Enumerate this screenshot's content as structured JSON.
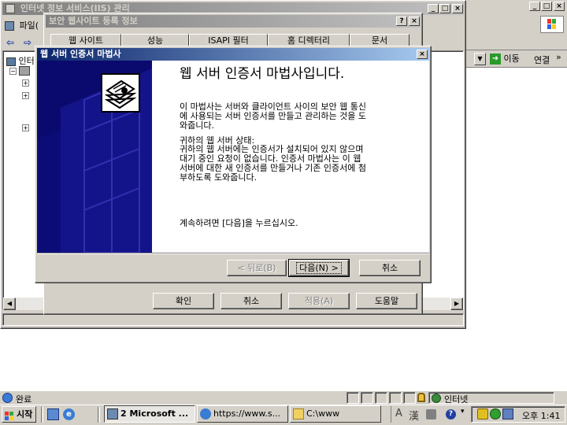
{
  "iis_window": {
    "title": "인터넷 정보 서비스(IIS) 관리",
    "menu_file": "파일(",
    "tree_root": "인터"
  },
  "props_dialog": {
    "title": "보안 웹사이트 등록 정보",
    "tabs": [
      "웹 사이트",
      "성능",
      "ISAPI 필터",
      "홈 디렉터리",
      "문서"
    ],
    "buttons": {
      "ok": "확인",
      "cancel": "취소",
      "apply": "적용(A)",
      "help": "도움말"
    }
  },
  "browser": {
    "go_label": "이동",
    "links_label": "연결",
    "status_text": "완료",
    "zone_text": "인터넷"
  },
  "wizard": {
    "title": "웹 서버 인증서 마법사",
    "heading": "웹 서버 인증서 마법사입니다.",
    "intro_line1": "이 마법사는 서버와 클라이언트 사이의 보안 웹 통신",
    "intro_line2": "에 사용되는 서버 인증서를 만들고 관리하는 것을 도",
    "intro_line3": "와줍니다.",
    "status_label": "귀하의 웹 서버 상태:",
    "status_line1": "귀하의 웹 서버에는 인증서가 설치되어 있지 않으며",
    "status_line2": "대기 중인 요청이 없습니다. 인증서 마법사는 이 웹",
    "status_line3": "서버에 대한 새 인증서를 만들거나 기존 인증서에 첨",
    "status_line4": "부하도록 도와줍니다.",
    "continue_text": "계속하려면 [다음]을 누르십시오.",
    "back_button": "< 뒤로(B)",
    "next_button": "다음(N) >",
    "cancel_button": "취소"
  },
  "taskbar": {
    "start_label": "시작",
    "tasks": [
      {
        "label": "2 Microsoft ..."
      },
      {
        "label": "https://www.s..."
      },
      {
        "label": "C:\\www"
      }
    ],
    "ime_a": "A",
    "ime_han": "漢",
    "clock": "오후 1:41"
  },
  "colors": {
    "title_active": "#0a246a",
    "title_inactive": "#808080",
    "face": "#d4d0c8",
    "wizard_banner": "#0a0a6e"
  }
}
